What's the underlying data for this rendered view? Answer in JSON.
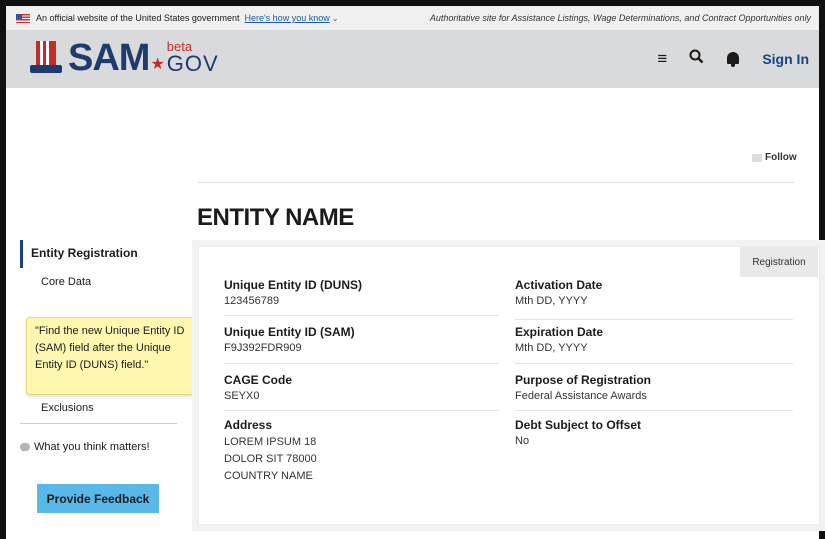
{
  "gov_banner": {
    "text": "An official website of the United States government",
    "link": "Here's how you know",
    "authoritative": "Authoritative site for Assistance Listings, Wage Determinations, and Contract Opportunities only"
  },
  "header": {
    "logo_main": "SAM",
    "logo_dot": "★",
    "logo_beta": "beta",
    "logo_gov": "GOV",
    "signin": "Sign In"
  },
  "follow_label": "Follow",
  "page_title": "ENTITY NAME",
  "sidenav": {
    "main": "Entity Registration",
    "core_data": "Core Data",
    "exclusions": "Exclusions",
    "matters": "What you think matters!",
    "feedback_button": "Provide Feedback"
  },
  "tooltip_text": "\"Find the new Unique Entity ID (SAM) field after the Unique Entity ID (DUNS) field.\"",
  "card": {
    "tab": "Registration",
    "left_fields": [
      {
        "label": "Unique Entity ID (DUNS)",
        "value": "123456789"
      },
      {
        "label": "Unique Entity ID (SAM)",
        "value": "F9J392FDR909"
      },
      {
        "label": "CAGE Code",
        "value": "SEYX0"
      },
      {
        "label": "Address",
        "value_lines": [
          "LOREM IPSUM 18",
          "DOLOR SIT 78000",
          "COUNTRY NAME"
        ]
      }
    ],
    "right_fields": [
      {
        "label": "Activation Date",
        "value": "Mth DD, YYYY"
      },
      {
        "label": "Expiration Date",
        "value": "Mth DD, YYYY"
      },
      {
        "label": "Purpose of Registration",
        "value": "Federal Assistance Awards"
      },
      {
        "label": "Debt Subject to Offset",
        "value": "No"
      }
    ]
  },
  "icons": {
    "menu": "menu-icon",
    "search": "search-icon",
    "bell": "bell-icon",
    "flag": "us-flag-icon",
    "feedback": "speech-bubble-icon"
  },
  "colors": {
    "nav_accent": "#1a4480",
    "feedback_button": "#5ab8e8",
    "tooltip_bg": "#fff7b0",
    "header_bg": "#d9dadc"
  }
}
